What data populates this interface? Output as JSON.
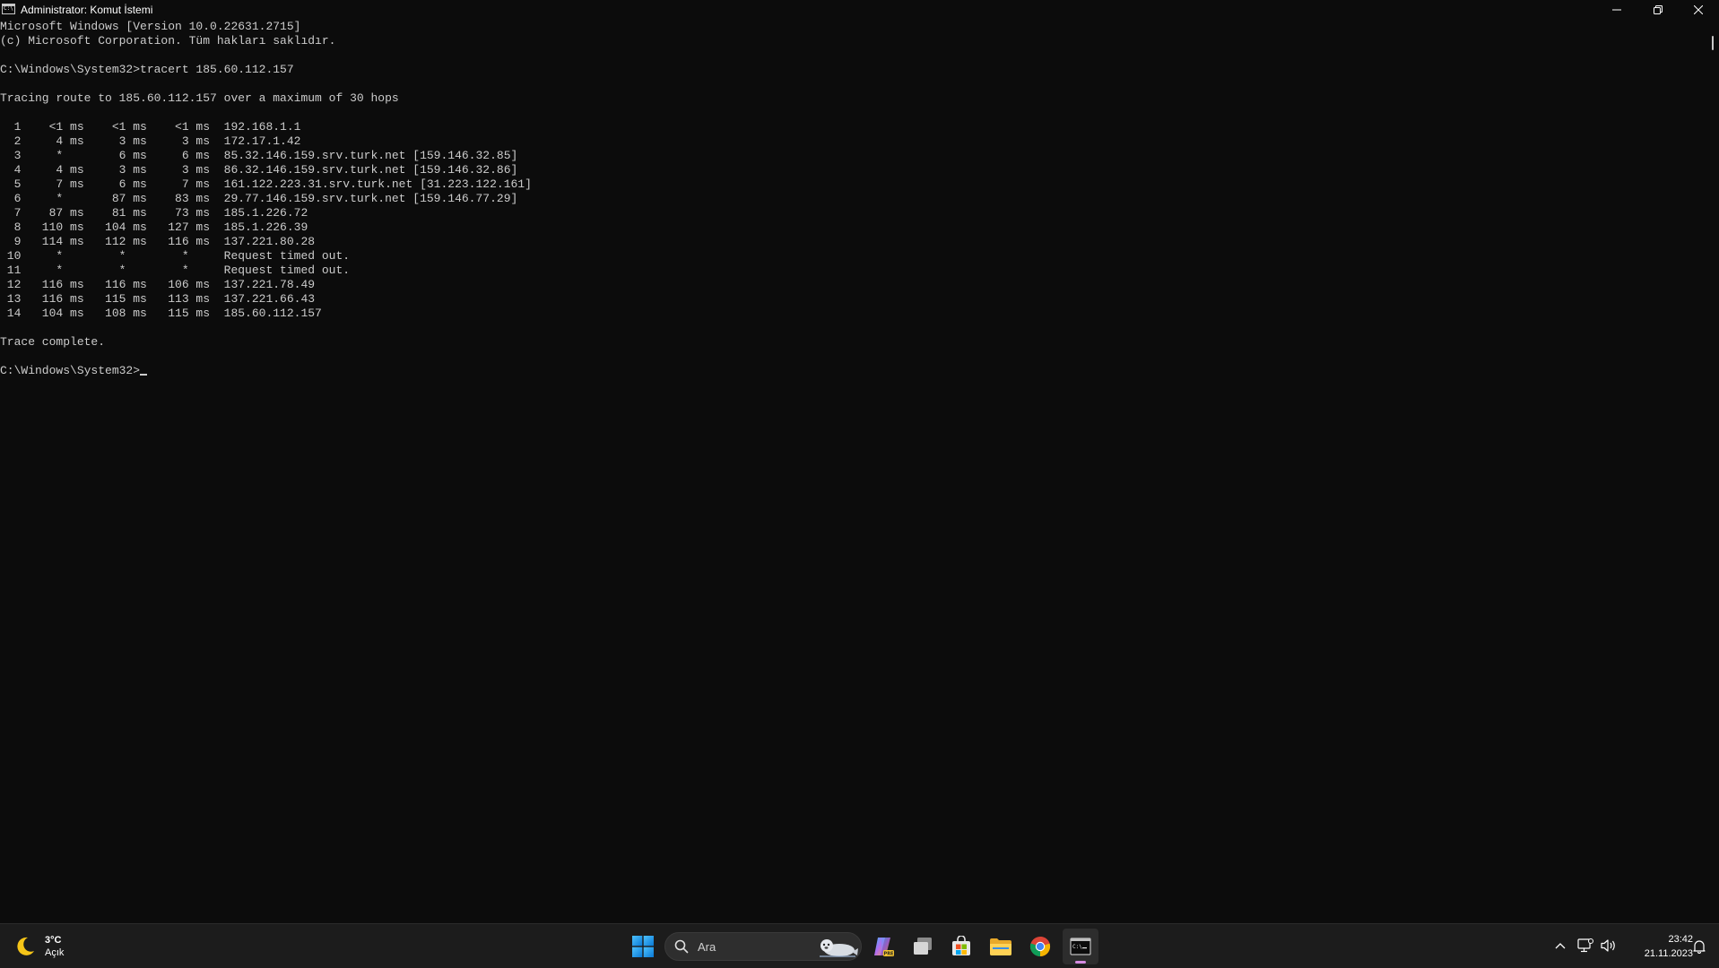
{
  "window": {
    "title": "Administrator: Komut İstemi"
  },
  "console": {
    "lines": [
      "Microsoft Windows [Version 10.0.22631.2715]",
      "(c) Microsoft Corporation. Tüm hakları saklıdır.",
      "",
      "C:\\Windows\\System32>tracert 185.60.112.157",
      "",
      "Tracing route to 185.60.112.157 over a maximum of 30 hops",
      "",
      "  1    <1 ms    <1 ms    <1 ms  192.168.1.1",
      "  2     4 ms     3 ms     3 ms  172.17.1.42",
      "  3     *        6 ms     6 ms  85.32.146.159.srv.turk.net [159.146.32.85]",
      "  4     4 ms     3 ms     3 ms  86.32.146.159.srv.turk.net [159.146.32.86]",
      "  5     7 ms     6 ms     7 ms  161.122.223.31.srv.turk.net [31.223.122.161]",
      "  6     *       87 ms    83 ms  29.77.146.159.srv.turk.net [159.146.77.29]",
      "  7    87 ms    81 ms    73 ms  185.1.226.72",
      "  8   110 ms   104 ms   127 ms  185.1.226.39",
      "  9   114 ms   112 ms   116 ms  137.221.80.28",
      " 10     *        *        *     Request timed out.",
      " 11     *        *        *     Request timed out.",
      " 12   116 ms   116 ms   106 ms  137.221.78.49",
      " 13   116 ms   115 ms   113 ms  137.221.66.43",
      " 14   104 ms   108 ms   115 ms  185.60.112.157",
      "",
      "Trace complete.",
      ""
    ],
    "prompt": "C:\\Windows\\System32>"
  },
  "taskbar": {
    "weather": {
      "temperature": "3°C",
      "condition": "Açık",
      "icon": "moon-icon"
    },
    "search": {
      "placeholder": "Ara",
      "icon": "search-icon"
    },
    "apps": [
      {
        "name": "start-button",
        "icon": "windows-logo-icon"
      },
      {
        "name": "copilot",
        "icon": "copilot-icon"
      },
      {
        "name": "task-view",
        "icon": "task-view-icon"
      },
      {
        "name": "microsoft-store",
        "icon": "store-icon"
      },
      {
        "name": "file-explorer",
        "icon": "folder-icon"
      },
      {
        "name": "chrome",
        "icon": "chrome-icon"
      },
      {
        "name": "terminal",
        "icon": "terminal-icon",
        "active": true
      }
    ],
    "tray": {
      "time": "23:42",
      "date": "21.11.2023"
    }
  },
  "colors": {
    "console_bg": "#0c0c0c",
    "console_fg": "#cccccc",
    "taskbar_bg": "#1c1c1c",
    "accent_indicator": "#d58be2"
  }
}
